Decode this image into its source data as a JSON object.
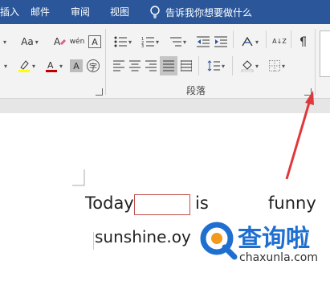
{
  "tabs": [
    "插入",
    "邮件",
    "审阅",
    "视图"
  ],
  "tell_me": "告诉我你想要做什么",
  "ribbon": {
    "font_size_label": "Aa",
    "wen_label": "wén",
    "boxed_a": "A",
    "shaded_a": "A",
    "circle_char": "字",
    "paragraph_group": "段落",
    "sort_label": "A↓Z"
  },
  "document": {
    "line1": [
      "Today",
      "is",
      "funny"
    ],
    "line2": "sunshine.oy"
  },
  "watermark": {
    "brand": "查询啦",
    "domain": "chaxunla.com"
  },
  "colors": {
    "title_bar": "#2b579a",
    "highlight": "#ffff00",
    "font_color": "#c00000",
    "arrow": "#e0383a",
    "watermark_blue": "#1f6fd1",
    "watermark_orange": "#f39a1e"
  }
}
